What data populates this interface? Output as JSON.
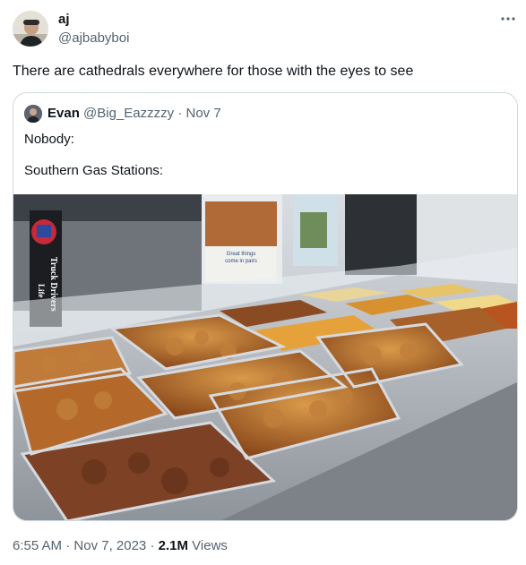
{
  "author": {
    "name": "aj",
    "handle": "@ajbabyboi"
  },
  "tweet": {
    "text": "There are cathedrals everywhere for those with the eyes to see"
  },
  "quoted": {
    "name": "Evan",
    "handle": "@Big_Eazzzzy",
    "separator": "·",
    "date": "Nov 7",
    "line1": "Nobody:",
    "line2": "Southern Gas Stations:",
    "image": {
      "sign_text_1": "Truck Drivers",
      "sign_text_2": "Life",
      "poster_line_1": "Great things",
      "poster_line_2": "come in pairs"
    }
  },
  "meta": {
    "time": "6:55 AM",
    "separator": "·",
    "date": "Nov 7, 2023",
    "views_count": "2.1M",
    "views_label": "Views"
  },
  "icons": {
    "more": "more-horizontal-icon"
  },
  "colors": {
    "text": "#0f1419",
    "secondary": "#536471",
    "border": "#cfd9de"
  }
}
